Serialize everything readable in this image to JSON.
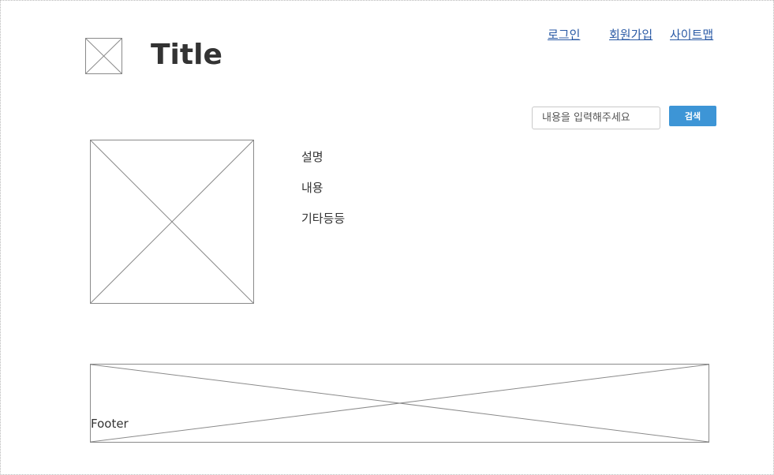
{
  "header": {
    "title": "Title",
    "nav": {
      "login": "로그인",
      "signup": "회원가입",
      "sitemap": "사이트맵"
    }
  },
  "search": {
    "placeholder": "내용을 입력해주세요",
    "button_label": "검색"
  },
  "content": {
    "lines": [
      "설명",
      "내용",
      "기타등등"
    ]
  },
  "footer": {
    "label": "Footer"
  },
  "colors": {
    "link": "#2a5aa5",
    "button": "#3d95d6",
    "placeholder_stroke": "#8a8a8a"
  }
}
